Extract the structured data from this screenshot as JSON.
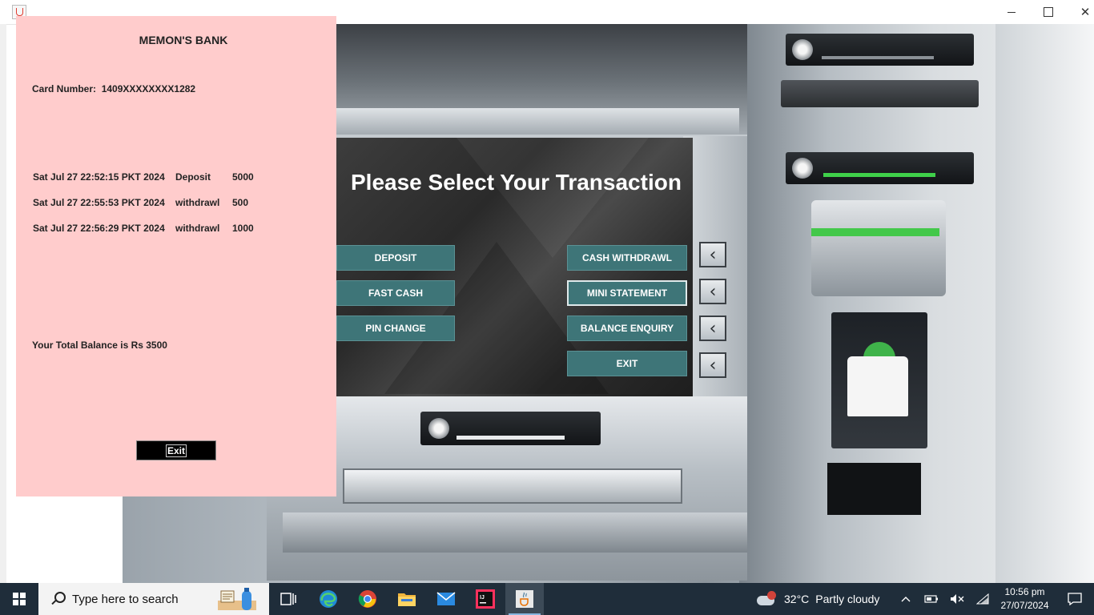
{
  "atm_window": {
    "screen_title": "Please Select Your Transaction",
    "buttons": {
      "deposit": "DEPOSIT",
      "fast_cash": "FAST CASH",
      "pin_change": "PIN CHANGE",
      "cash_withdrawl": "CASH WITHDRAWL",
      "mini_statement": "MINI STATEMENT",
      "balance_enquiry": "BALANCE ENQUIRY",
      "exit": "EXIT"
    },
    "side_keys": [
      "‹",
      "‹",
      "‹",
      "‹"
    ],
    "colors": {
      "button_bg": "#3e7578",
      "screen_bg": "#2a2a2a"
    }
  },
  "mini_statement": {
    "bank_name": "MEMON'S BANK",
    "card_label": "Card Number:",
    "card_number": "1409XXXXXXXX1282",
    "transactions": [
      {
        "date": "Sat Jul 27 22:52:15 PKT 2024",
        "type": "Deposit",
        "amount": "5000"
      },
      {
        "date": "Sat Jul 27 22:55:53 PKT 2024",
        "type": "withdrawl",
        "amount": "500"
      },
      {
        "date": "Sat Jul 27 22:56:29 PKT 2024",
        "type": "withdrawl",
        "amount": "1000"
      }
    ],
    "balance_text": "Your Total Balance is Rs 3500",
    "exit_label": "Exit",
    "colors": {
      "background": "#ffcccc"
    }
  },
  "taskbar": {
    "search_placeholder": "Type here to search",
    "weather": {
      "temperature": "32°C",
      "condition": "Partly cloudy"
    },
    "clock": {
      "time": "10:56 pm",
      "date": "27/07/2024"
    },
    "pinned_icons": [
      "task-view-icon",
      "edge-icon",
      "chrome-icon",
      "file-explorer-icon",
      "mail-icon",
      "intellij-icon",
      "java-icon"
    ]
  }
}
